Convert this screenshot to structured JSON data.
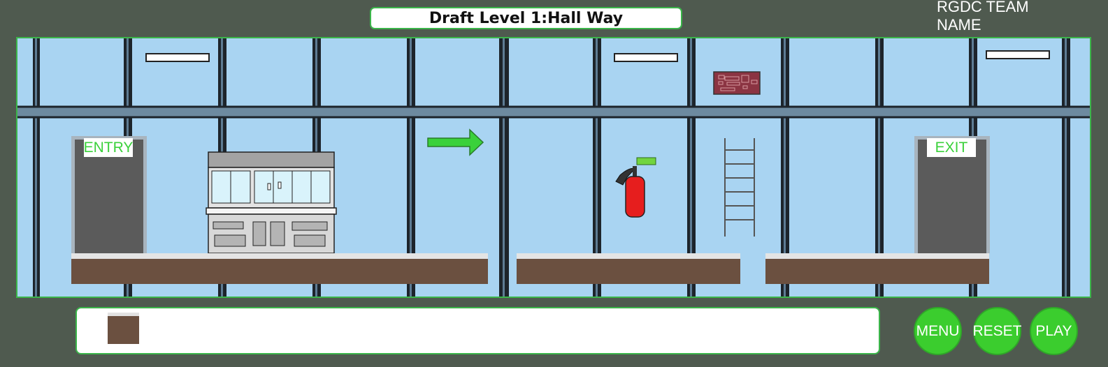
{
  "header": {
    "level_title": "Draft Level 1:Hall Way",
    "team_name": "RGDC  TEAM NAME"
  },
  "scene": {
    "background_color": "#a9d4f2",
    "entry_label": "ENTRY",
    "exit_label": "EXIT",
    "objects": [
      "entry-door",
      "vending-cabinet",
      "direction-arrow",
      "fire-extinguisher",
      "wall-control-panel",
      "wall-ladder",
      "exit-door",
      "ceiling-lights",
      "floor-platforms"
    ]
  },
  "inventory": {
    "items": [
      "floor-block"
    ]
  },
  "buttons": {
    "menu": "MENU",
    "reset": "RESET",
    "play": "PLAY"
  },
  "colors": {
    "accent_green": "#3bcd2e",
    "frame_border": "#3bb54a",
    "platform_brown": "#6b5040",
    "background": "#4f5a4f"
  }
}
